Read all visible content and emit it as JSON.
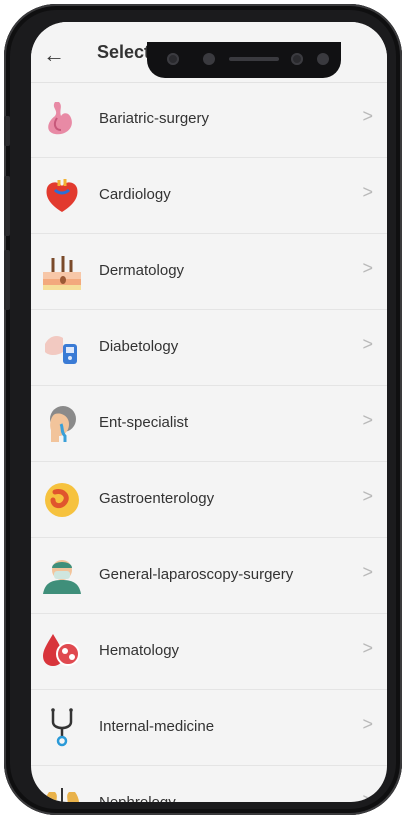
{
  "appbar": {
    "title": "Select Speciality",
    "back_icon": "arrow-left-icon"
  },
  "specialities": [
    {
      "label": "Bariatric-surgery",
      "icon": "stomach-icon"
    },
    {
      "label": "Cardiology",
      "icon": "heart-icon"
    },
    {
      "label": "Dermatology",
      "icon": "skin-layers-icon"
    },
    {
      "label": "Diabetology",
      "icon": "glucose-meter-icon"
    },
    {
      "label": "Ent-specialist",
      "icon": "ear-nose-throat-icon"
    },
    {
      "label": "Gastroenterology",
      "icon": "digestive-icon"
    },
    {
      "label": "General-laparoscopy-surgery",
      "icon": "surgeon-icon"
    },
    {
      "label": "Hematology",
      "icon": "blood-cells-icon"
    },
    {
      "label": "Internal-medicine",
      "icon": "stethoscope-icon"
    },
    {
      "label": "Nephrology",
      "icon": "kidney-icon"
    }
  ],
  "chevron": ">",
  "colors": {
    "background": "#f4f4f4",
    "divider": "#e4e4e4",
    "text": "#333333",
    "chevron": "#b9b9b9"
  }
}
